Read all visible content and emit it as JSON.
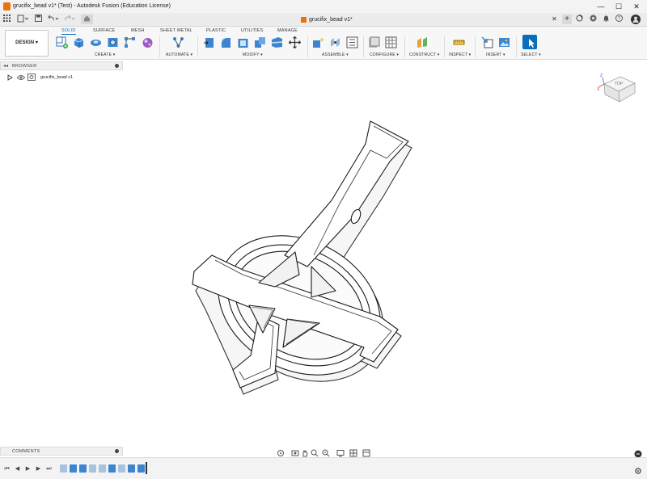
{
  "window": {
    "title": "grucifix_bead v1* (Test) - Autodesk Fusion (Education License)",
    "minimize": "—",
    "maximize": "☐",
    "close": "✕"
  },
  "quickaccess": {
    "doc_tab_title": "grucifix_bead v1*",
    "tab_close": "✕",
    "new_tab": "+"
  },
  "ribbon": {
    "workspace": "DESIGN",
    "tabs": [
      "SOLID",
      "SURFACE",
      "MESH",
      "SHEET METAL",
      "PLASTIC",
      "UTILITIES",
      "MANAGE"
    ],
    "active_tab": "SOLID",
    "groups": [
      "CREATE",
      "AUTOMATE",
      "MODIFY",
      "ASSEMBLE",
      "CONFIGURE",
      "CONSTRUCT",
      "INSPECT",
      "INSERT",
      "SELECT"
    ]
  },
  "browser": {
    "title": "BROWSER",
    "root_item": "grucifix_bead v1"
  },
  "comments": {
    "title": "COMMENTS"
  },
  "viewcube": {
    "face": "TOP",
    "axis_x": "X",
    "axis_z": "Z"
  },
  "colors": {
    "accent": "#0a6ebd",
    "brand_orange": "#e8730c"
  }
}
